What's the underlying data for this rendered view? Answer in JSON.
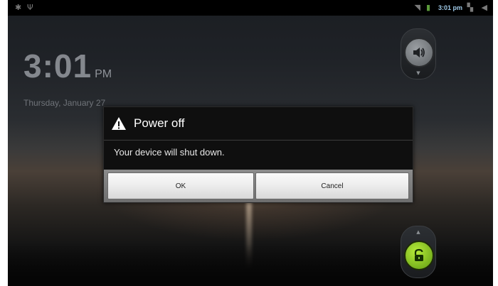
{
  "status_bar": {
    "left_icons": [
      "android-debug-icon",
      "usb-icon"
    ],
    "right_icons": [
      "wifi-icon",
      "battery-icon",
      "signal-icon",
      "volume-icon"
    ],
    "time": "3:01 pm"
  },
  "lockscreen": {
    "clock_time": "3:01",
    "clock_ampm": "PM",
    "date": "Thursday, January 27",
    "sound_toggle_icon": "volume-icon",
    "unlock_icon": "unlock-icon"
  },
  "dialog": {
    "title": "Power off",
    "title_icon": "warning-icon",
    "message": "Your device will shut down.",
    "ok_label": "OK",
    "cancel_label": "Cancel"
  },
  "colors": {
    "dialog_bg": "#0f0f0f",
    "unlock_green": "#8cc63f",
    "status_time": "#9ec8e6"
  }
}
